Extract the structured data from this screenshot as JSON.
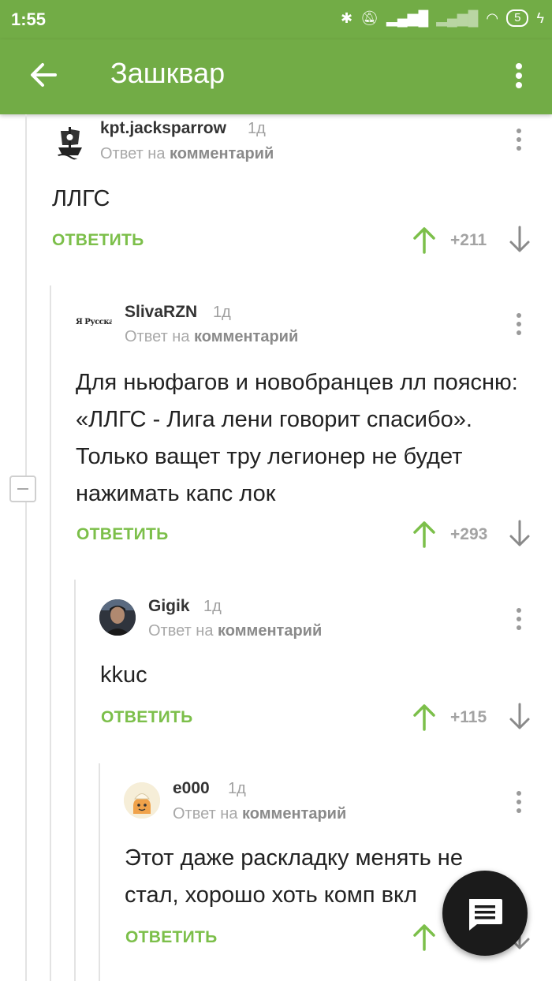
{
  "status_bar": {
    "time": "1:55",
    "battery": "5"
  },
  "app_bar": {
    "title": "Зашквар"
  },
  "colors": {
    "accent": "#72ac46",
    "reply_green": "#7cbf4a",
    "muted": "#a0a0a0"
  },
  "comments": [
    {
      "author": "kpt.jacksparrow",
      "age": "1д",
      "reply_prefix": "Ответ на",
      "reply_target": "комментарий",
      "text": "ЛЛГС",
      "reply_label": "ОТВЕТИТЬ",
      "rating": "+211",
      "avatar_icon": "pirate-ship-icon"
    },
    {
      "author": "SlivaRZN",
      "age": "1д",
      "reply_prefix": "Ответ на",
      "reply_target": "комментарий",
      "text": "Для ньюфагов и новобранцев лл поясню: «ЛЛГС - Лига лени говорит спасибо». Только ващет  тру легионер не будет нажимать капс лок",
      "reply_label": "ОТВЕТИТЬ",
      "rating": "+293",
      "avatar_text": "Я Русская"
    },
    {
      "author": "Gigik",
      "age": "1д",
      "reply_prefix": "Ответ на",
      "reply_target": "комментарий",
      "text": "kkuc",
      "reply_label": "ОТВЕТИТЬ",
      "rating": "+115",
      "avatar_icon": "portrait-icon"
    },
    {
      "author": "e000",
      "age": "1д",
      "reply_prefix": "Ответ на",
      "reply_target": "комментарий",
      "text": "Этот даже раскладку менять не стал, хорошо хоть комп вкл",
      "reply_label": "ОТВЕТИТЬ",
      "avatar_icon": "cartoon-avatar-icon"
    }
  ],
  "fab_icon": "comment-icon"
}
